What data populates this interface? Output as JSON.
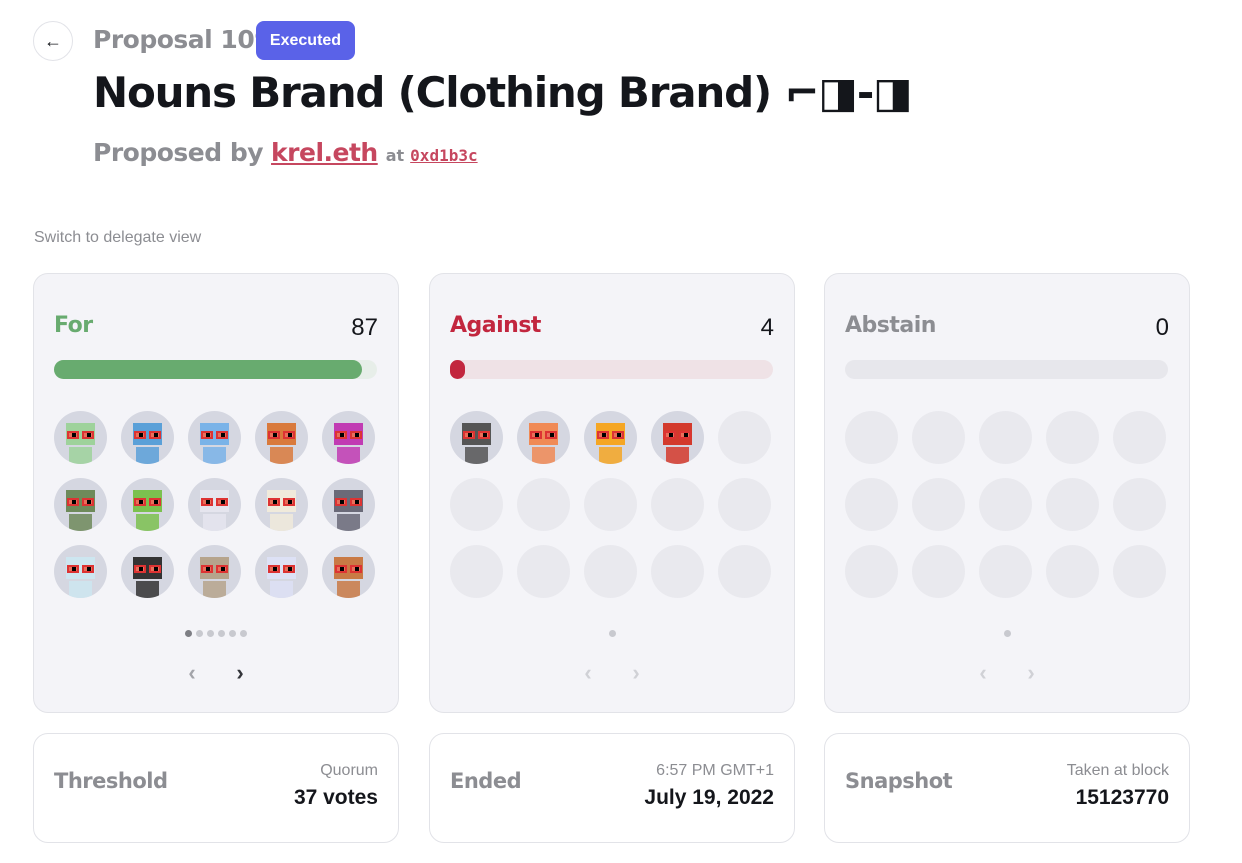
{
  "header": {
    "back_icon": "←",
    "proposal_number": "Proposal 109",
    "status": "Executed",
    "title": "Nouns Brand (Clothing Brand) ⌐◨-◨",
    "proposed_by_prefix": "Proposed by",
    "proposer": "krel.eth",
    "at_text": "at",
    "tx_hash": "0xd1b3c"
  },
  "switch_view_label": "Switch to delegate view",
  "colors": {
    "for": "#68ab6f",
    "for_track": "#e7eee9",
    "against": "#c2263e",
    "against_track": "#efe2e6",
    "abstain": "#8c8d92",
    "abstain_track": "#e7e7ec",
    "accent": "#5a62e8"
  },
  "vote_cards": [
    {
      "label": "For",
      "count": "87",
      "fill_fraction": 0.955,
      "filled_avatars": 15
    },
    {
      "label": "Against",
      "count": "4",
      "fill_fraction": 0.046,
      "filled_avatars": 4
    },
    {
      "label": "Abstain",
      "count": "0",
      "fill_fraction": 0,
      "filled_avatars": 0
    }
  ],
  "info_cards": [
    {
      "label": "Threshold",
      "sub": "Quorum",
      "value": "37 votes"
    },
    {
      "label": "Ended",
      "sub": "6:57 PM GMT+1",
      "value": "July 19, 2022"
    },
    {
      "label": "Snapshot",
      "sub": "Taken at block",
      "value": "15123770"
    }
  ],
  "pager": {
    "prev_icon": "‹",
    "next_icon": "›"
  },
  "icons": {
    "back": "arrow-left-icon",
    "prev": "chevron-left-icon",
    "next": "chevron-right-icon"
  }
}
